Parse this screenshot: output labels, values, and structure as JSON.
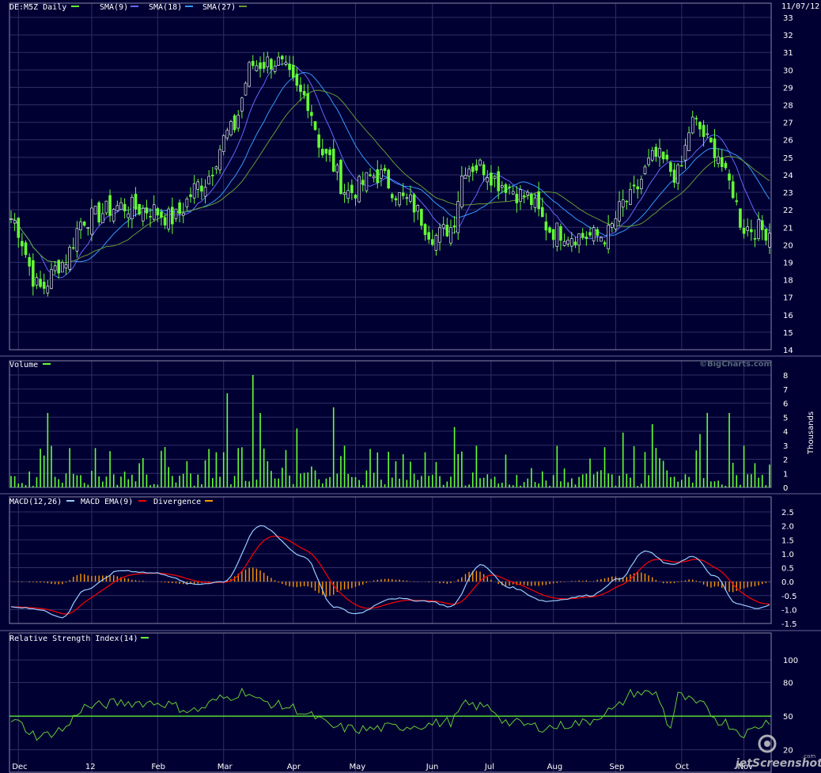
{
  "colors": {
    "background": "#000033",
    "grid": "#2f2f66",
    "price": "#66ff33",
    "sma9": "#6666ff",
    "sma18": "#3399ff",
    "sma27": "#669933",
    "volume": "#66ff33",
    "macd": "#99ccff",
    "macd_ema": "#ff0000",
    "divergence": "#ff9900",
    "rsi": "#66cc33",
    "rsi_ref": "#66ff33"
  },
  "header": {
    "symbol": "DE:M5Z Daily",
    "sma9": "SMA(9)",
    "sma18": "SMA(18)",
    "sma27": "SMA(27)",
    "date": "11/07/12",
    "volume": "Volume",
    "watermark": "©BigCharts.com",
    "macd": "MACD(12,26)",
    "macd_ema": "MACD EMA(9)",
    "divergence": "Divergence",
    "rsi": "Relative Strength Index(14)",
    "volume_unit": "Thousands",
    "jet_watermark": "jetScreenshot",
    "jet_com": ".com"
  },
  "chart_data": [
    {
      "type": "candlestick",
      "title": "DE:M5Z Daily",
      "series_names": [
        "SMA(9)",
        "SMA(18)",
        "SMA(27)"
      ],
      "ylim": [
        14,
        33
      ],
      "y_ticks": [
        "14",
        "15",
        "16",
        "17",
        "18",
        "19",
        "20",
        "21",
        "22",
        "23",
        "24",
        "25",
        "26",
        "27",
        "28",
        "29",
        "30",
        "31",
        "32",
        "33"
      ],
      "x_labels": [
        "Dec",
        "12",
        "Feb",
        "Mar",
        "Apr",
        "May",
        "Jun",
        "Jul",
        "Aug",
        "Sep",
        "Oct",
        "Nov"
      ],
      "x_label_positions": [
        2,
        22,
        40,
        58,
        77,
        94,
        115,
        131,
        148,
        165,
        183,
        200
      ],
      "close_keypoints": [
        [
          0,
          21.5
        ],
        [
          8,
          17.5
        ],
        [
          14,
          19.0
        ],
        [
          20,
          21.5
        ],
        [
          30,
          22.2
        ],
        [
          38,
          22.0
        ],
        [
          44,
          21.5
        ],
        [
          52,
          23.5
        ],
        [
          60,
          26.5
        ],
        [
          66,
          30.3
        ],
        [
          72,
          30.5
        ],
        [
          80,
          28.5
        ],
        [
          86,
          25.0
        ],
        [
          92,
          23.0
        ],
        [
          100,
          24.0
        ],
        [
          108,
          22.5
        ],
        [
          116,
          20.5
        ],
        [
          120,
          21.0
        ],
        [
          124,
          24.5
        ],
        [
          128,
          24.5
        ],
        [
          134,
          23.5
        ],
        [
          140,
          22.8
        ],
        [
          148,
          20.8
        ],
        [
          156,
          20.5
        ],
        [
          162,
          20.5
        ],
        [
          168,
          22.5
        ],
        [
          176,
          25.0
        ],
        [
          182,
          24.0
        ],
        [
          186,
          27.0
        ],
        [
          192,
          25.5
        ],
        [
          196,
          23.5
        ],
        [
          200,
          21.0
        ],
        [
          207,
          20.8
        ]
      ],
      "candle_count": 208
    },
    {
      "type": "bar",
      "title": "Volume",
      "ylabel": "Thousands",
      "ylim": [
        0,
        8
      ],
      "y_ticks": [
        "0",
        "1",
        "2",
        "3",
        "4",
        "5",
        "6",
        "7",
        "8"
      ],
      "spikes": [
        [
          10,
          5.3
        ],
        [
          16,
          2.8
        ],
        [
          23,
          2.8
        ],
        [
          59,
          6.7
        ],
        [
          66,
          8.0
        ],
        [
          68,
          5.3
        ],
        [
          78,
          4.2
        ],
        [
          88,
          5.7
        ],
        [
          121,
          4.3
        ],
        [
          167,
          3.9
        ],
        [
          175,
          4.5
        ],
        [
          188,
          3.8
        ],
        [
          190,
          5.3
        ],
        [
          196,
          5.3
        ]
      ]
    },
    {
      "type": "line",
      "title": "MACD(12,26)",
      "series_names": [
        "MACD(12,26)",
        "MACD EMA(9)",
        "Divergence"
      ],
      "ylim": [
        -1.5,
        2.5
      ],
      "y_ticks": [
        "-1.5",
        "-1.0",
        "-0.5",
        "0.0",
        "0.5",
        "1.0",
        "1.5",
        "2.0",
        "2.5"
      ],
      "macd_keypoints": [
        [
          0,
          -0.9
        ],
        [
          8,
          -1.0
        ],
        [
          14,
          -1.3
        ],
        [
          20,
          -0.3
        ],
        [
          30,
          0.4
        ],
        [
          40,
          0.3
        ],
        [
          50,
          -0.1
        ],
        [
          58,
          0.0
        ],
        [
          68,
          2.0
        ],
        [
          80,
          0.9
        ],
        [
          88,
          -0.9
        ],
        [
          94,
          -1.15
        ],
        [
          104,
          -0.6
        ],
        [
          114,
          -0.7
        ],
        [
          120,
          -0.9
        ],
        [
          128,
          0.6
        ],
        [
          136,
          -0.2
        ],
        [
          146,
          -0.7
        ],
        [
          158,
          -0.5
        ],
        [
          166,
          0.1
        ],
        [
          173,
          1.1
        ],
        [
          180,
          0.6
        ],
        [
          186,
          0.9
        ],
        [
          192,
          0.2
        ],
        [
          198,
          -0.8
        ],
        [
          203,
          -0.95
        ],
        [
          207,
          -0.85
        ]
      ]
    },
    {
      "type": "line",
      "title": "Relative Strength Index(14)",
      "ylim": [
        0,
        100
      ],
      "y_ticks": [
        "20",
        "50",
        "80",
        "100"
      ],
      "reference_level": 50,
      "rsi_keypoints": [
        [
          0,
          46
        ],
        [
          8,
          32
        ],
        [
          14,
          38
        ],
        [
          20,
          58
        ],
        [
          30,
          62
        ],
        [
          40,
          62
        ],
        [
          50,
          55
        ],
        [
          58,
          66
        ],
        [
          64,
          72
        ],
        [
          68,
          63
        ],
        [
          76,
          58
        ],
        [
          82,
          50
        ],
        [
          88,
          40
        ],
        [
          96,
          38
        ],
        [
          104,
          40
        ],
        [
          112,
          42
        ],
        [
          120,
          45
        ],
        [
          124,
          60
        ],
        [
          130,
          58
        ],
        [
          136,
          44
        ],
        [
          146,
          40
        ],
        [
          156,
          44
        ],
        [
          164,
          55
        ],
        [
          170,
          71
        ],
        [
          176,
          70
        ],
        [
          180,
          40
        ],
        [
          182,
          68
        ],
        [
          188,
          60
        ],
        [
          194,
          45
        ],
        [
          200,
          35
        ],
        [
          207,
          45
        ]
      ]
    }
  ]
}
